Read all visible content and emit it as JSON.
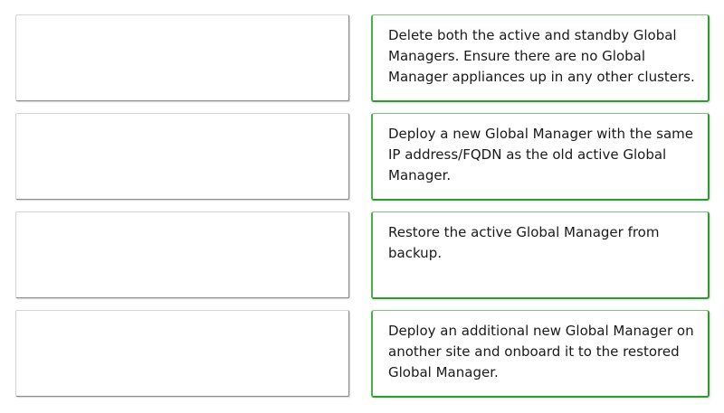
{
  "drop_slots": [
    {
      "content": ""
    },
    {
      "content": ""
    },
    {
      "content": ""
    },
    {
      "content": ""
    }
  ],
  "answers": [
    {
      "text": "Delete both the active and standby Global Managers. Ensure there are no Global Manager appliances up in any other clusters."
    },
    {
      "text": "Deploy a new Global Manager with the same IP address/FQDN as the old active Global Manager."
    },
    {
      "text": "Restore the active Global Manager from backup."
    },
    {
      "text": "Deploy an additional new Global Manager on another site and onboard it to the restored Global Manager."
    }
  ],
  "colors": {
    "card_border_accent": "#2e9b2e",
    "slot_border": "#8c8c8c",
    "text": "#1a1a1a"
  }
}
